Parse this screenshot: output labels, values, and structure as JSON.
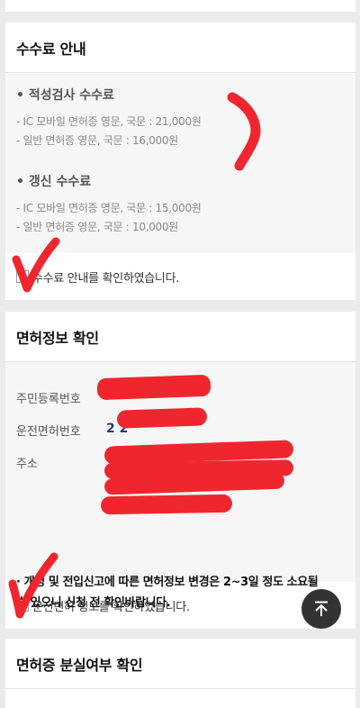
{
  "fee_card": {
    "title": "수수료 안내",
    "aptitude": {
      "heading": "• 적성검사 수수료",
      "lines": [
        "- IC 모바일 면허증 영문, 국문 : 21,000원",
        "- 일반 면허증 영문, 국문 : 16,000원"
      ]
    },
    "renewal": {
      "heading": "• 갱신 수수료",
      "lines": [
        "- IC 모바일 면허증 영문, 국문 : 15,000원",
        "- 일반 면허증 영문, 국문 : 10,000원"
      ]
    },
    "confirm_label": "수수료 안내를 확인하였습니다."
  },
  "license_card": {
    "title": "면허정보 확인",
    "rows": [
      {
        "key": "주민등록번호",
        "value": ""
      },
      {
        "key": "운전면허번호",
        "value": "2   2"
      },
      {
        "key": "주소",
        "value": ""
      }
    ],
    "notice": "· 개명 및 전입신고에 따른 면허정보 변경은 2~3일 정도 소요될 수 있으니 신청 전 확인바랍니다.",
    "confirm_label": "운전면허 정보를 확인하였습니다."
  },
  "lost_card": {
    "title": "면허증 분실여부 확인"
  },
  "colors": {
    "accent_text": "#1e3c78",
    "fab_bg": "#333333",
    "annotation_red": "#f0262f"
  }
}
